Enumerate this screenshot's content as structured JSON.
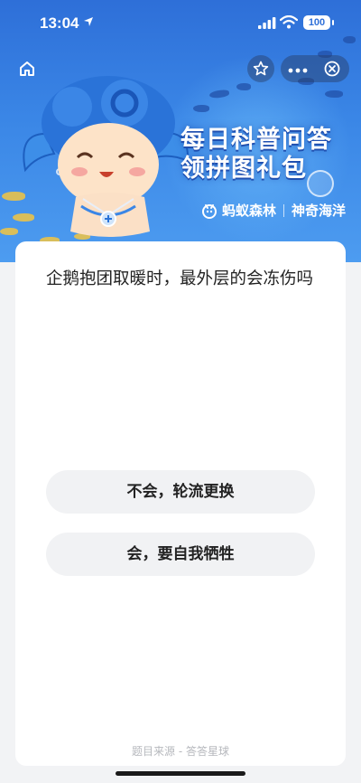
{
  "status_bar": {
    "time": "13:04",
    "battery": "100"
  },
  "banner": {
    "title_line1": "每日科普问答",
    "title_line2": "领拼图礼包",
    "brand_left": "蚂蚁森林",
    "brand_right": "神奇海洋"
  },
  "icons": {
    "home": "home-icon",
    "star": "star-icon",
    "more": "more-icon",
    "close": "close-circle-icon",
    "ant": "ant-forest-icon"
  },
  "quiz": {
    "question": "企鹅抱团取暖时，最外层的会冻伤吗",
    "options": [
      "不会，轮流更换",
      "会，要自我牺牲"
    ],
    "source": "题目来源 - 答答星球"
  },
  "colors": {
    "banner_top": "#2e6fd8",
    "banner_bottom": "#4d9cf0",
    "option_bg": "#f1f2f4"
  }
}
